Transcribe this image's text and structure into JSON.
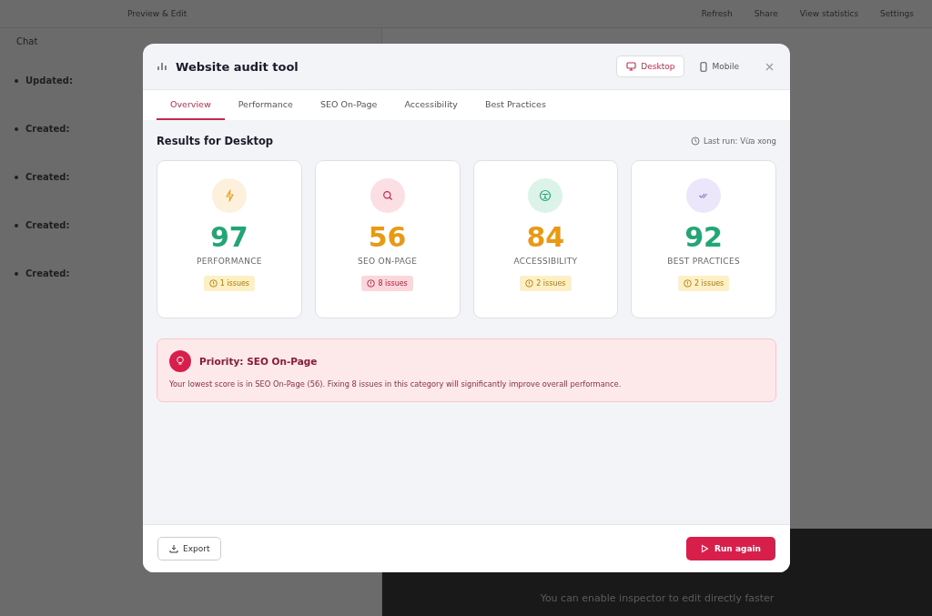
{
  "background": {
    "toolbar": [
      "Preview & Edit",
      "Refresh",
      "Share",
      "View statistics",
      "Settings"
    ],
    "chat_title": "Chat",
    "chat_items": [
      {
        "label": "Updated:"
      },
      {
        "label": "Created:"
      },
      {
        "label": "Created:"
      },
      {
        "label": "Created:"
      },
      {
        "label": "Created:"
      }
    ],
    "hint": "You can enable inspector to edit directly faster"
  },
  "modal": {
    "title": "Website audit tool",
    "devices": [
      {
        "label": "Desktop",
        "kind": "desktop",
        "selected": true
      },
      {
        "label": "Mobile",
        "kind": "mobile",
        "selected": false
      }
    ],
    "tabs": [
      {
        "label": "Overview",
        "selected": true
      },
      {
        "label": "Performance",
        "selected": false
      },
      {
        "label": "SEO On-Page",
        "selected": false
      },
      {
        "label": "Accessibility",
        "selected": false
      },
      {
        "label": "Best Practices",
        "selected": false
      }
    ],
    "results_heading": "Results for Desktop",
    "last_run": "Last run: Vừa xong",
    "cards": [
      {
        "kind": "performance",
        "score": "97",
        "label": "PERFORMANCE",
        "issues": "1 issues",
        "critical": false,
        "color": "#22a676"
      },
      {
        "kind": "seo",
        "score": "56",
        "label": "SEO ON-PAGE",
        "issues": "8 issues",
        "critical": true,
        "color": "#e89a14"
      },
      {
        "kind": "accessibility",
        "score": "84",
        "label": "ACCESSIBILITY",
        "issues": "2 issues",
        "critical": false,
        "color": "#e89a14"
      },
      {
        "kind": "best",
        "score": "92",
        "label": "BEST PRACTICES",
        "issues": "2 issues",
        "critical": false,
        "color": "#22a676"
      }
    ],
    "priority": {
      "title": "Priority: SEO On-Page",
      "text": "Your lowest score is in SEO On-Page (56). Fixing 8 issues in this category will significantly improve overall performance."
    },
    "export": "Export",
    "run_again": "Run again"
  }
}
